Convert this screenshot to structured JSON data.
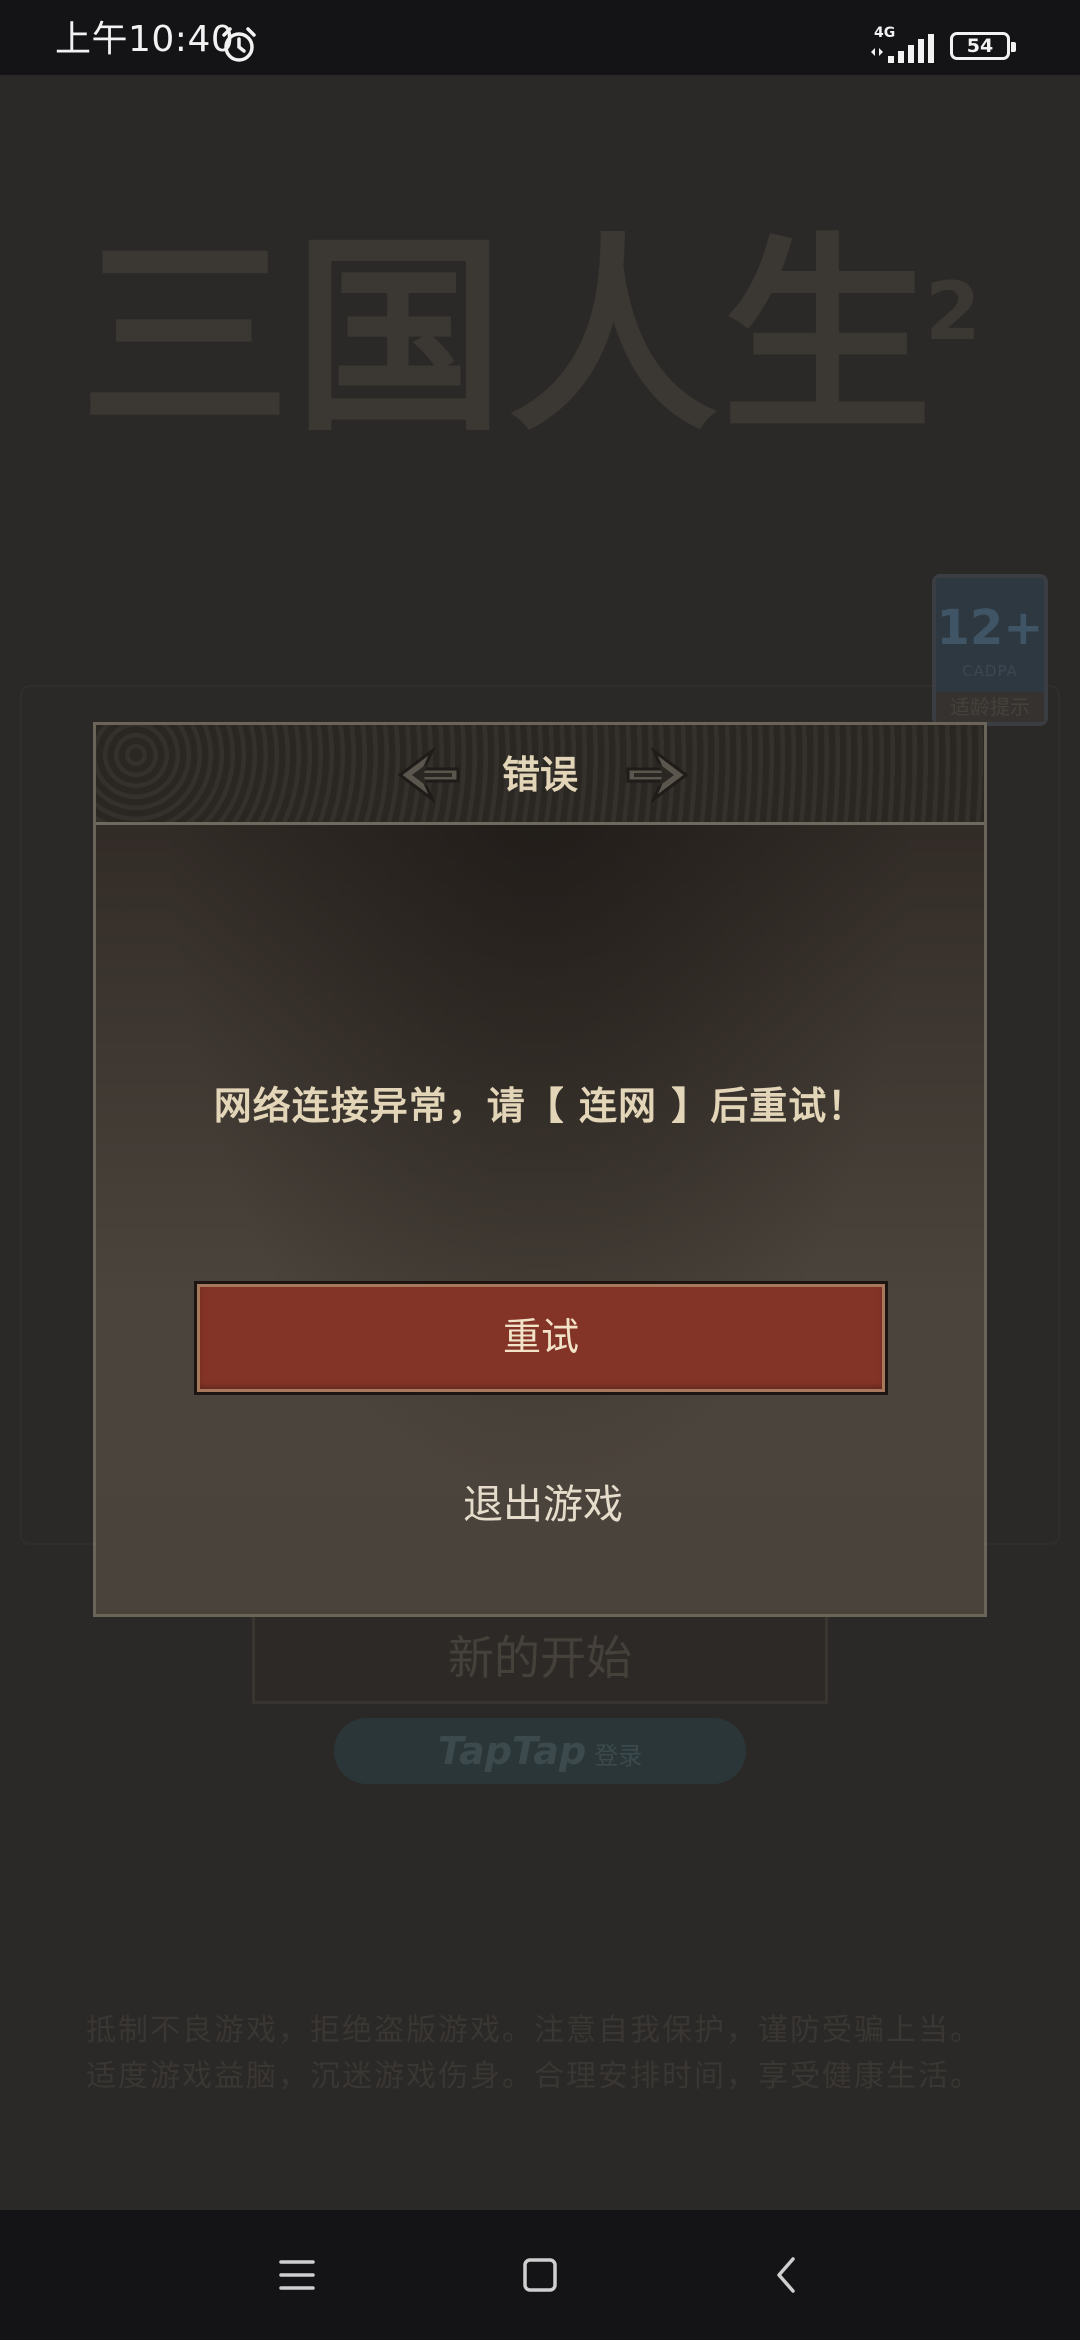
{
  "status_bar": {
    "time": "上午10:40",
    "network": "4G",
    "battery": "54"
  },
  "background": {
    "game_title": "三国人生",
    "title_superscript": "2",
    "age_rating": {
      "rating": "12+",
      "org": "CADPA",
      "tip": "适龄提示"
    },
    "new_start_label": "新的开始",
    "taptap": {
      "logo": "TapTap",
      "login": "登录"
    },
    "health_notice": [
      "抵制不良游戏，拒绝盗版游戏。注意自我保护，谨防受骗上当。",
      "适度游戏益脑，沉迷游戏伤身。合理安排时间，享受健康生活。"
    ]
  },
  "dialog": {
    "title": "错误",
    "message": "网络连接异常，请【 连网 】后重试！",
    "retry_label": "重试",
    "exit_label": "退出游戏"
  },
  "colors": {
    "retry_button": "#843426",
    "dialog_text": "#e3d5b8",
    "status_bar": "#141315"
  }
}
